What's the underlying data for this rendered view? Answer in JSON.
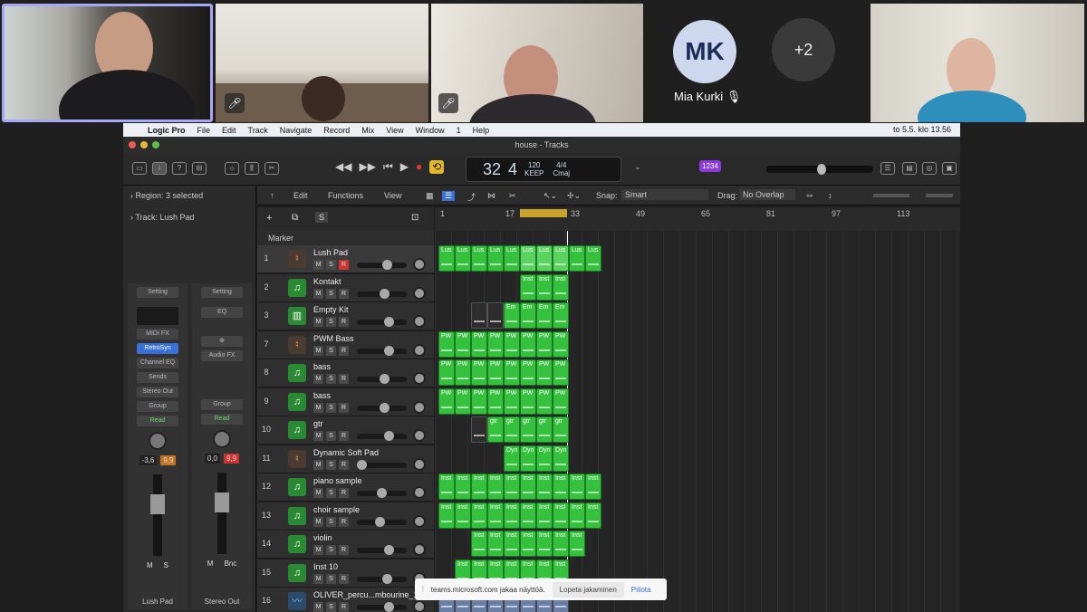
{
  "video": {
    "mia_kurki": {
      "initials": "MK",
      "name": "Mia Kurki"
    },
    "more_participants": "+2"
  },
  "logic": {
    "menu": [
      "Logic Pro",
      "File",
      "Edit",
      "Track",
      "Navigate",
      "Record",
      "Mix",
      "View",
      "Window",
      "1",
      "Help"
    ],
    "clock": "to 5.5. klo 13.56",
    "window_title": "house - Tracks",
    "lcd": {
      "bar": "32",
      "beat": "4",
      "bar_label": "BAR",
      "beat_label": "BEAT",
      "tempo": "120",
      "keep": "KEEP",
      "tempo_label": "TEMPO",
      "sig": "4/4",
      "key": "Cmaj"
    },
    "count_in": "1234",
    "region_label": "Region:",
    "region_value": "3 selected",
    "track_label": "Track:",
    "track_value": "Lush Pad",
    "strip1": {
      "setting": "Setting",
      "midi_fx": "MIDI FX",
      "synth": "RetroSyn",
      "eq": "Channel EQ",
      "sends": "Sends",
      "out": "Stereo Out",
      "group": "Group",
      "read": "Read",
      "val1": "-3,6",
      "val2": "9,9",
      "m": "M",
      "s": "S",
      "name": "Lush Pad"
    },
    "strip2": {
      "setting": "Setting",
      "eq": "EQ",
      "audio_fx": "Audio FX",
      "group": "Group",
      "read": "Read",
      "val1": "0,0",
      "val2": "9,9",
      "m": "M",
      "bnc": "Bnc",
      "name": "Stereo Out"
    },
    "subtoolbar": {
      "edit": "Edit",
      "functions": "Functions",
      "view": "View",
      "snap_label": "Snap:",
      "snap": "Smart",
      "drag_label": "Drag:",
      "drag": "No Overlap"
    },
    "marker": "Marker",
    "ruler": [
      "1",
      "17",
      "33",
      "49",
      "65",
      "81",
      "97",
      "113"
    ],
    "tracks": [
      {
        "num": "1",
        "name": "Lush Pad",
        "icon": "synth-icon",
        "rec": true
      },
      {
        "num": "2",
        "name": "Kontakt",
        "icon": "instrument-icon"
      },
      {
        "num": "3",
        "name": "Empty Kit",
        "icon": "drum-kit-icon"
      },
      {
        "num": "7",
        "name": "PWM Bass",
        "icon": "synth-icon"
      },
      {
        "num": "8",
        "name": "bass",
        "icon": "instrument-icon"
      },
      {
        "num": "9",
        "name": "bass",
        "icon": "instrument-icon"
      },
      {
        "num": "10",
        "name": "gtr",
        "icon": "instrument-icon"
      },
      {
        "num": "11",
        "name": "Dynamic Soft Pad",
        "icon": "synth-icon"
      },
      {
        "num": "12",
        "name": "piano sample",
        "icon": "instrument-icon"
      },
      {
        "num": "13",
        "name": "choir sample",
        "icon": "instrument-icon"
      },
      {
        "num": "14",
        "name": "violin",
        "icon": "instrument-icon"
      },
      {
        "num": "15",
        "name": "Inst 10",
        "icon": "instrument-icon"
      },
      {
        "num": "16",
        "name": "OLIVER_percu...mbourine_103",
        "icon": "audio-icon"
      }
    ],
    "region_labels": [
      "Lus",
      "Inst",
      "Em",
      "PW",
      "gtr",
      "Dyn"
    ]
  },
  "share_bar": {
    "message": "teams.microsoft.com jakaa näyttöä.",
    "stop": "Lopeta jakaminen",
    "hide": "Piilota"
  }
}
